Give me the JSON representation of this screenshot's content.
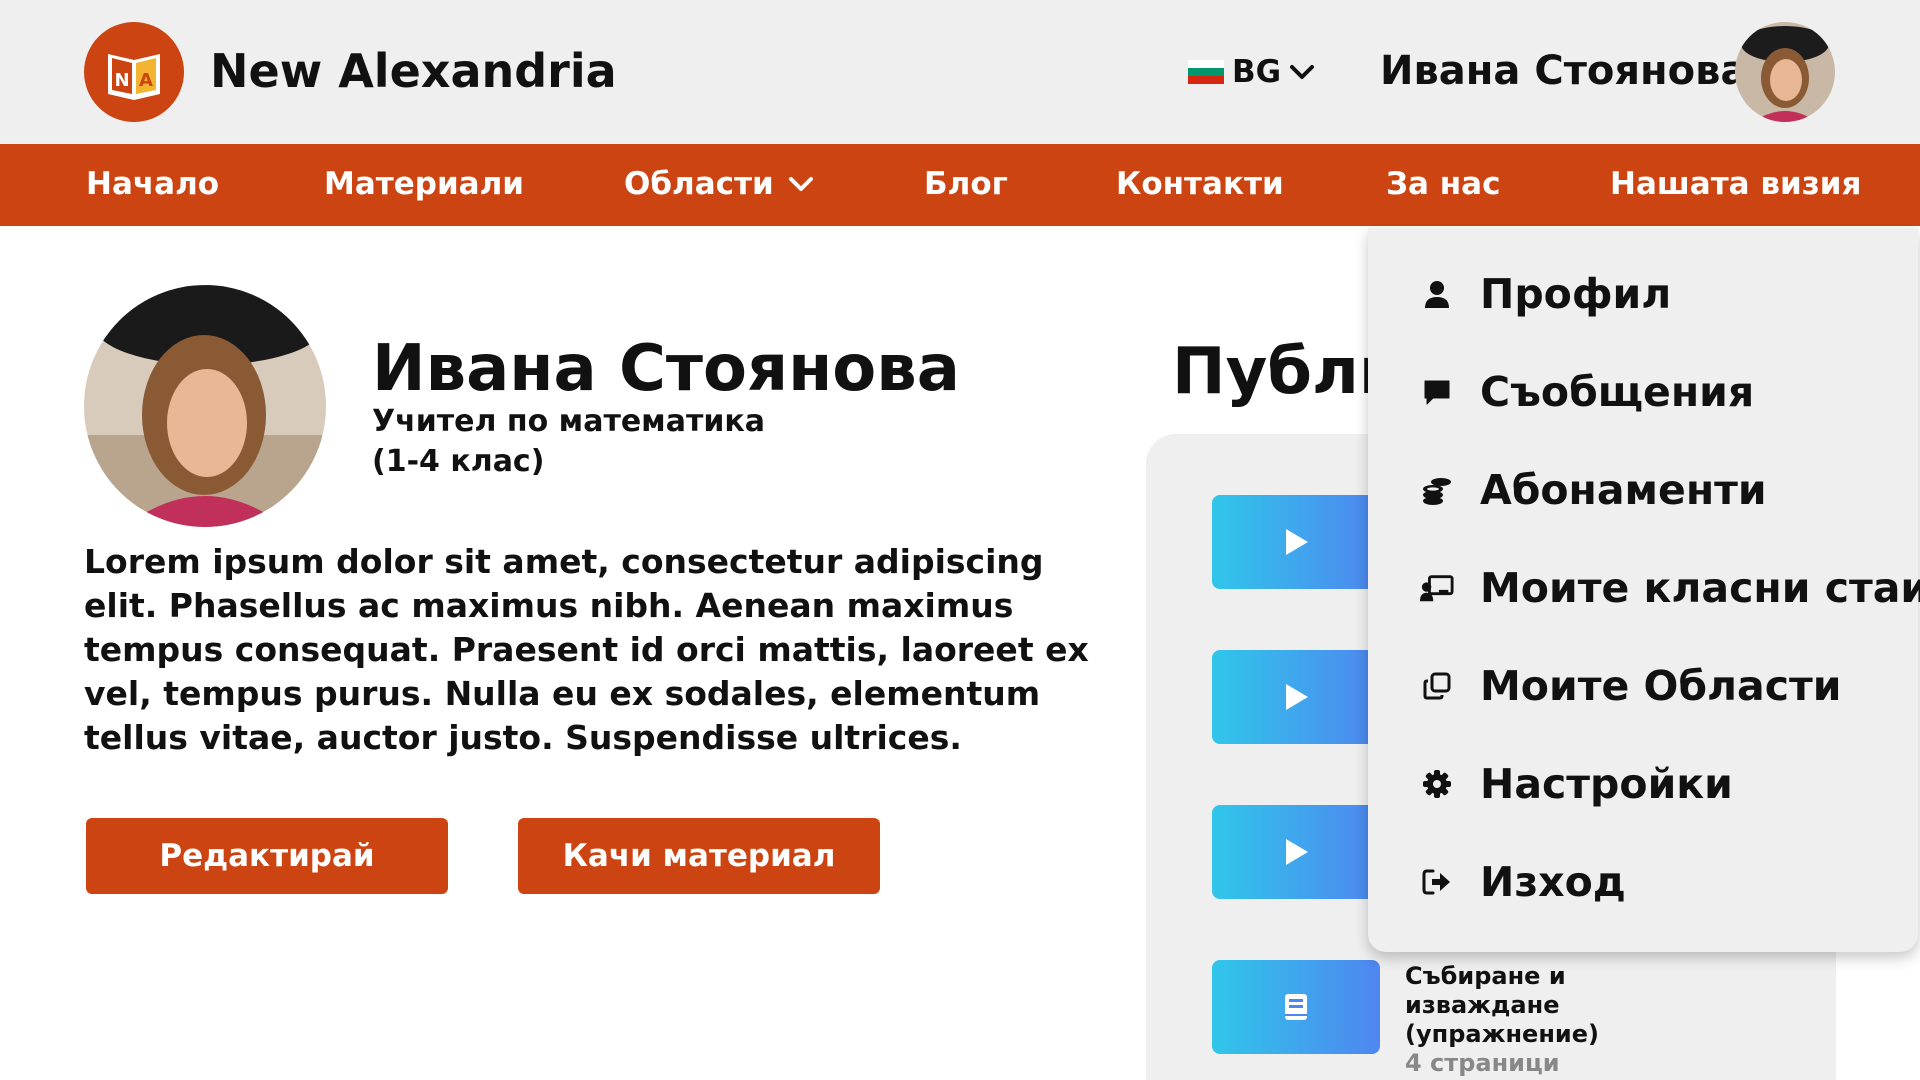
{
  "header": {
    "brand": "New Alexandria",
    "logo_letters": "NA",
    "language": "BG",
    "user_name": "Ивана Стоянова"
  },
  "nav": {
    "items": [
      {
        "label": "Начало"
      },
      {
        "label": "Материали"
      },
      {
        "label": "Области"
      },
      {
        "label": "Блог"
      },
      {
        "label": "Контакти"
      },
      {
        "label": "За нас"
      },
      {
        "label": "Нашата визия"
      }
    ]
  },
  "profile": {
    "name": "Ивана Стоянова",
    "role": "Учител по математика (1-4 клас)",
    "bio": "Lorem ipsum dolor sit amet, consectetur adipiscing elit. Phasellus ac maximus nibh. Aenean maximus tempus consequat. Praesent id orci mattis, laoreet ex vel, tempus purus. Nulla eu ex sodales, elementum tellus vitae, auctor justo. Suspendisse ultrices.",
    "edit_label": "Редактирай",
    "upload_label": "Качи материал"
  },
  "publications": {
    "title": "Публикации",
    "items": [
      {
        "icon": "play-icon"
      },
      {
        "icon": "play-icon"
      },
      {
        "icon": "play-icon"
      },
      {
        "icon": "book-icon",
        "title": "Събиране и изваждане (упражнение)",
        "subtitle": "4 страници"
      }
    ]
  },
  "user_menu": {
    "items": [
      {
        "label": "Профил",
        "icon": "user-icon"
      },
      {
        "label": "Съобщения",
        "icon": "message-icon"
      },
      {
        "label": "Абонаменти",
        "icon": "coins-icon"
      },
      {
        "label": "Моите класни стаи",
        "icon": "classroom-icon"
      },
      {
        "label": "Моите Области",
        "icon": "copy-icon"
      },
      {
        "label": "Настройки",
        "icon": "gear-icon"
      },
      {
        "label": "Изход",
        "icon": "logout-icon"
      }
    ]
  },
  "colors": {
    "brand": "#cc4411",
    "header_bg": "#efefef",
    "thumb_gradient_start": "#30c6ea",
    "thumb_gradient_end": "#4f86f0"
  }
}
